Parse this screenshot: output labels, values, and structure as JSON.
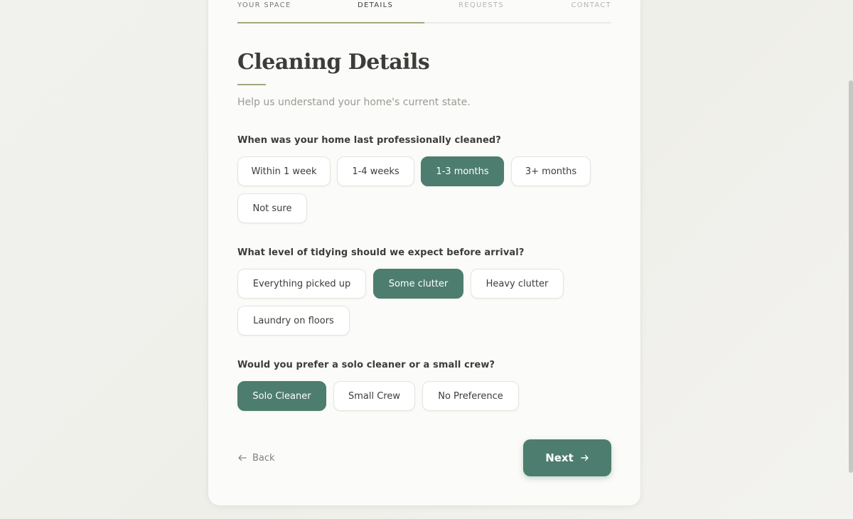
{
  "steps": [
    {
      "label": "YOUR SPACE",
      "state": "done"
    },
    {
      "label": "DETAILS",
      "state": "active"
    },
    {
      "label": "REQUESTS",
      "state": "pending"
    },
    {
      "label": "CONTACT",
      "state": "pending"
    }
  ],
  "progress_fraction": 0.5,
  "page": {
    "title": "Cleaning Details",
    "subtitle": "Help us understand your home's current state."
  },
  "questions": [
    {
      "label": "When was your home last professionally cleaned?",
      "options": [
        "Within 1 week",
        "1-4 weeks",
        "1-3 months",
        "3+ months",
        "Not sure"
      ],
      "selected": "1-3 months"
    },
    {
      "label": "What level of tidying should we expect before arrival?",
      "options": [
        "Everything picked up",
        "Some clutter",
        "Heavy clutter",
        "Laundry on floors"
      ],
      "selected": "Some clutter"
    },
    {
      "label": "Would you prefer a solo cleaner or a small crew?",
      "options": [
        "Solo Cleaner",
        "Small Crew",
        "No Preference"
      ],
      "selected": "Solo Cleaner"
    }
  ],
  "nav": {
    "back_label": "Back",
    "next_label": "Next",
    "back_icon": "arrow-left-icon",
    "next_icon": "arrow-right-icon"
  },
  "colors": {
    "accent": "#4d7d6e",
    "progress": "#a7a57d",
    "title": "#3c3c39"
  }
}
